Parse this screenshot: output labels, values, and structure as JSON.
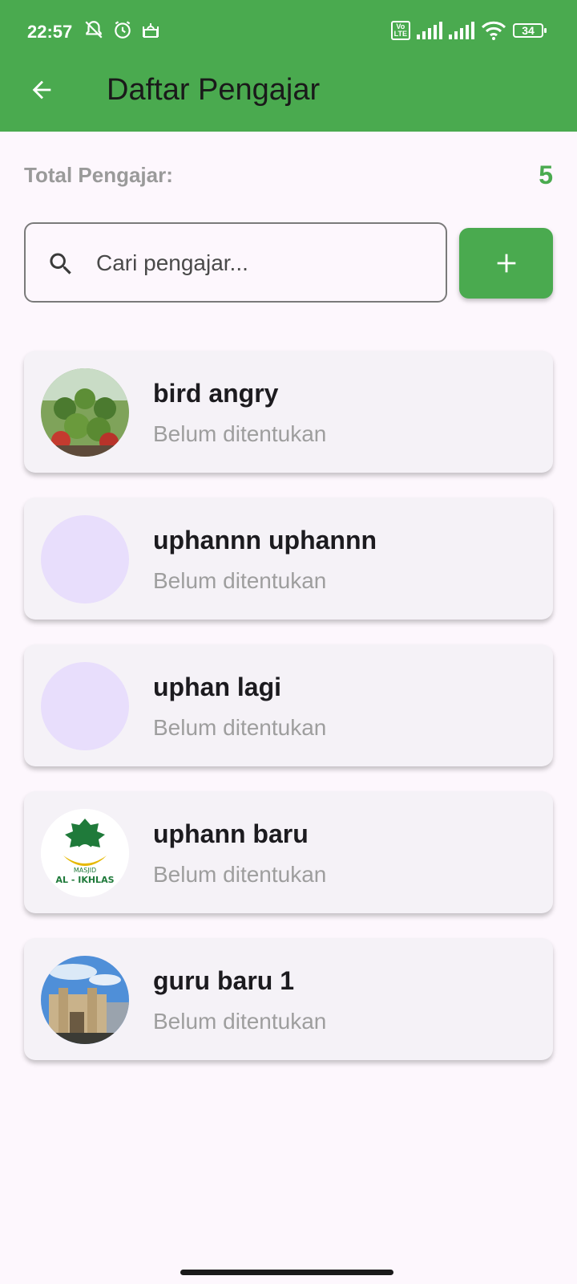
{
  "status_bar": {
    "time": "22:57",
    "battery": "34",
    "volte": "Vo\nLTE"
  },
  "header": {
    "title": "Daftar Pengajar"
  },
  "summary": {
    "label": "Total Pengajar:",
    "value": "5"
  },
  "search": {
    "placeholder": "Cari pengajar..."
  },
  "teachers": [
    {
      "name": "bird angry",
      "subtitle": "Belum ditentukan",
      "avatar": "photo"
    },
    {
      "name": "uphannn uphannn",
      "subtitle": "Belum ditentukan",
      "avatar": "none"
    },
    {
      "name": "uphan lagi",
      "subtitle": "Belum ditentukan",
      "avatar": "none"
    },
    {
      "name": "uphann baru",
      "subtitle": "Belum ditentukan",
      "avatar": "logo",
      "logo_text": [
        "MASJID",
        "AL - IKHLAS"
      ]
    },
    {
      "name": "guru baru 1",
      "subtitle": "Belum ditentukan",
      "avatar": "photo"
    }
  ],
  "colors": {
    "primary": "#4aaa4f",
    "background": "#fdf7fd",
    "card": "#f5f2f7",
    "avatar_placeholder": "#e8defc"
  }
}
